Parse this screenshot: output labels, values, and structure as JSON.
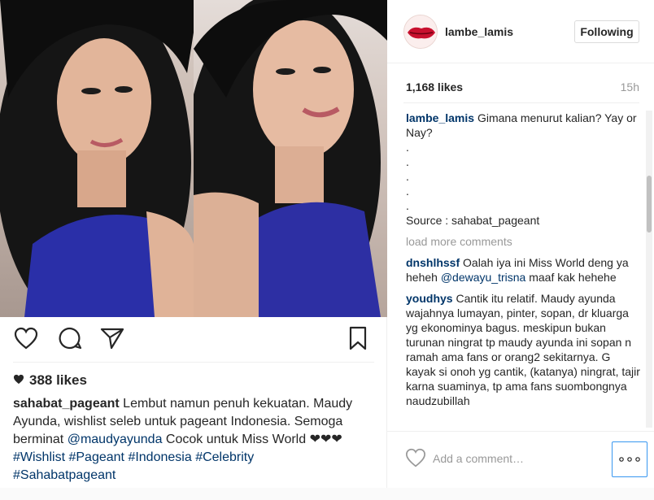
{
  "post": {
    "likes_count": "388 likes",
    "caption_user": "sahabat_pageant",
    "caption_text_1": "Lembut namun penuh kekuatan. Maudy Ayunda, wishlist seleb untuk pageant Indonesia. Semoga berminat ",
    "caption_mention": "@maudyayunda",
    "caption_text_2": " Cocok untuk Miss World ❤❤❤",
    "caption_tags": [
      "#Wishlist",
      "#Pageant",
      "#Indonesia",
      "#Celebrity",
      "#Sahabatpageant"
    ]
  },
  "side": {
    "username": "lambe_lamis",
    "follow_label": "Following",
    "likes": "1,168 likes",
    "time": "15h",
    "main_comment": {
      "user": "lambe_lamis",
      "text": "Gimana menurut kalian? Yay or Nay?",
      "dots": [
        ".",
        ".",
        ".",
        ".",
        "."
      ],
      "source": "Source : sahabat_pageant"
    },
    "load_more": "load more comments",
    "comments": [
      {
        "user": "dnshlhssf",
        "text_1": "Oalah iya ini Miss World deng ya heheh ",
        "mention": "@dewayu_trisna",
        "text_2": " maaf kak hehehe"
      },
      {
        "user": "youdhys",
        "text_1": "Cantik itu relatif. Maudy ayunda wajahnya lumayan, pinter, sopan, dr kluarga yg ekonominya bagus. meskipun bukan turunan ningrat tp maudy ayunda ini sopan n ramah ama fans or orang2 sekitarnya. G kayak si onoh yg cantik, (katanya) ningrat, tajir karna suaminya, tp ama fans suombongnya naudzubillah",
        "mention": "",
        "text_2": ""
      }
    ],
    "comment_placeholder": "Add a comment…"
  },
  "icons": {
    "like": "heart-icon",
    "comment": "comment-bubble-icon",
    "share": "paper-plane-icon",
    "save": "bookmark-icon",
    "more": "more-options-icon"
  },
  "colors": {
    "link": "#003569",
    "accent": "#3897f0",
    "muted": "#999999"
  }
}
